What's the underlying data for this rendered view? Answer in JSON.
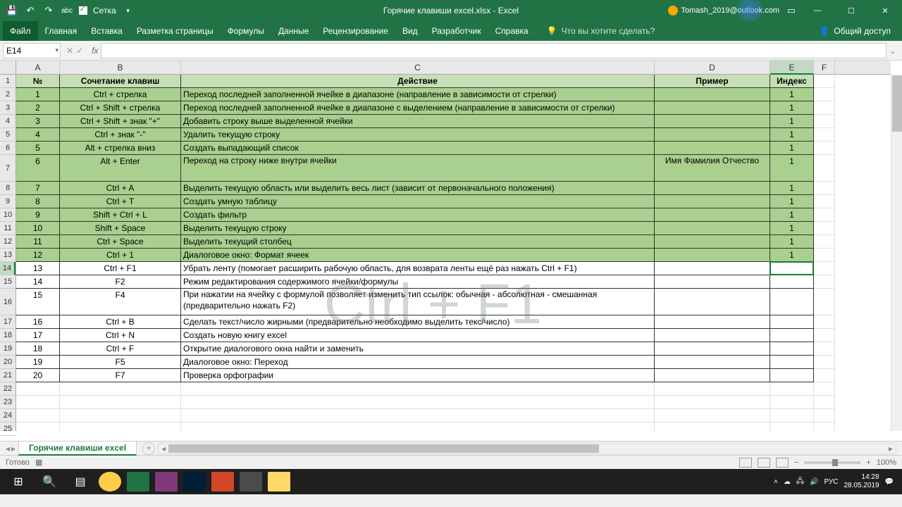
{
  "titlebar": {
    "title": "Горячие клавиши excel.xlsx - Excel",
    "grid_label": "Сетка",
    "user": "Tomash_2019@outlook.com"
  },
  "ribbon": {
    "tabs": [
      "Файл",
      "Главная",
      "Вставка",
      "Разметка страницы",
      "Формулы",
      "Данные",
      "Рецензирование",
      "Вид",
      "Разработчик",
      "Справка"
    ],
    "tellme": "Что вы хотите сделать?",
    "share": "Общий доступ"
  },
  "formula": {
    "name_box": "E14"
  },
  "columns": [
    "A",
    "B",
    "C",
    "D",
    "E",
    "F"
  ],
  "row_headers": [
    "1",
    "2",
    "3",
    "4",
    "5",
    "6",
    "7",
    "8",
    "9",
    "10",
    "11",
    "12",
    "13",
    "14",
    "15",
    "16",
    "17",
    "18",
    "19",
    "20",
    "21",
    "22",
    "23",
    "24",
    "25"
  ],
  "headers": {
    "a": "№",
    "b": "Сочетание клавиш",
    "c": "Действие",
    "d": "Пример",
    "e": "Индекс"
  },
  "rows": [
    {
      "n": "1",
      "k": "Ctrl + стрелка",
      "a": "Переход последней заполненной ячейке в диапазоне (направление в зависимости от стрелки)",
      "d": "",
      "i": "1",
      "g": true
    },
    {
      "n": "2",
      "k": "Ctrl + Shift + стрелка",
      "a": "Переход последней заполненной ячейке в диапазоне с выделением (направление в зависимости от стрелки)",
      "d": "",
      "i": "1",
      "g": true
    },
    {
      "n": "3",
      "k": "Ctrl + Shift + знак \"+\"",
      "a": "Добавить строку выше выделенной ячейки",
      "d": "",
      "i": "1",
      "g": true
    },
    {
      "n": "4",
      "k": "Ctrl + знак \"-\"",
      "a": "Удалить текущую строку",
      "d": "",
      "i": "1",
      "g": true
    },
    {
      "n": "5",
      "k": "Alt + стрелка вниз",
      "a": "Создать выпадающий список",
      "d": "",
      "i": "1",
      "g": true
    },
    {
      "n": "6",
      "k": "Alt + Enter",
      "a": "Переход на строку ниже внутри ячейки",
      "d": "Имя Фамилия Отчество",
      "i": "1",
      "g": true,
      "tall": true
    },
    {
      "n": "7",
      "k": "Ctrl + A",
      "a": "Выделить текущую область или выделить весь лист (зависит от первоначального положения)",
      "d": "",
      "i": "1",
      "g": true
    },
    {
      "n": "8",
      "k": "Ctrl + T",
      "a": "Создать умную таблицу",
      "d": "",
      "i": "1",
      "g": true
    },
    {
      "n": "9",
      "k": "Shift + Ctrl + L",
      "a": "Создать фильтр",
      "d": "",
      "i": "1",
      "g": true
    },
    {
      "n": "10",
      "k": "Shift + Space",
      "a": "Выделить текущую строку",
      "d": "",
      "i": "1",
      "g": true
    },
    {
      "n": "11",
      "k": "Ctrl + Space",
      "a": "Выделить текущий столбец",
      "d": "",
      "i": "1",
      "g": true
    },
    {
      "n": "12",
      "k": "Ctrl + 1",
      "a": "Диалоговое окно: Формат ячеек",
      "d": "",
      "i": "1",
      "g": true
    },
    {
      "n": "13",
      "k": "Ctrl + F1",
      "a": "Убрать ленту (помогает расширить рабочую область, для возврата ленты ещё раз нажать Ctrl + F1)",
      "d": "",
      "i": "",
      "g": false
    },
    {
      "n": "14",
      "k": "F2",
      "a": "Режим редактирования содержимого ячейки/формулы",
      "d": "",
      "i": "",
      "g": false
    },
    {
      "n": "15",
      "k": "F4",
      "a": "При нажатии на ячейку с формулой позволяет изменить тип ссылок:\nобычная - абсолютная - смешанная (предварительно нажать F2)",
      "d": "",
      "i": "",
      "g": false,
      "tall": true
    },
    {
      "n": "16",
      "k": "Ctrl + B",
      "a": "Сделать текст/число жирными (предварительно необходимо выделить текс/число)",
      "d": "",
      "i": "",
      "g": false
    },
    {
      "n": "17",
      "k": "Ctrl + N",
      "a": "Создать новую книгу excel",
      "d": "",
      "i": "",
      "g": false
    },
    {
      "n": "18",
      "k": "Ctrl + F",
      "a": "Открытие диалогового окна найти и заменить",
      "d": "",
      "i": "",
      "g": false
    },
    {
      "n": "19",
      "k": "F5",
      "a": "Диалоговое окно: Переход",
      "d": "",
      "i": "",
      "g": false
    },
    {
      "n": "20",
      "k": "F7",
      "a": "Проверка орфографии",
      "d": "",
      "i": "",
      "g": false
    }
  ],
  "watermark": "Ctrl + F1",
  "sheet": {
    "name": "Горячие клавиши excel"
  },
  "status": {
    "ready": "Готово",
    "zoom": "100%"
  },
  "taskbar": {
    "lang": "РУС",
    "time": "14:28",
    "date": "28.05.2019"
  }
}
